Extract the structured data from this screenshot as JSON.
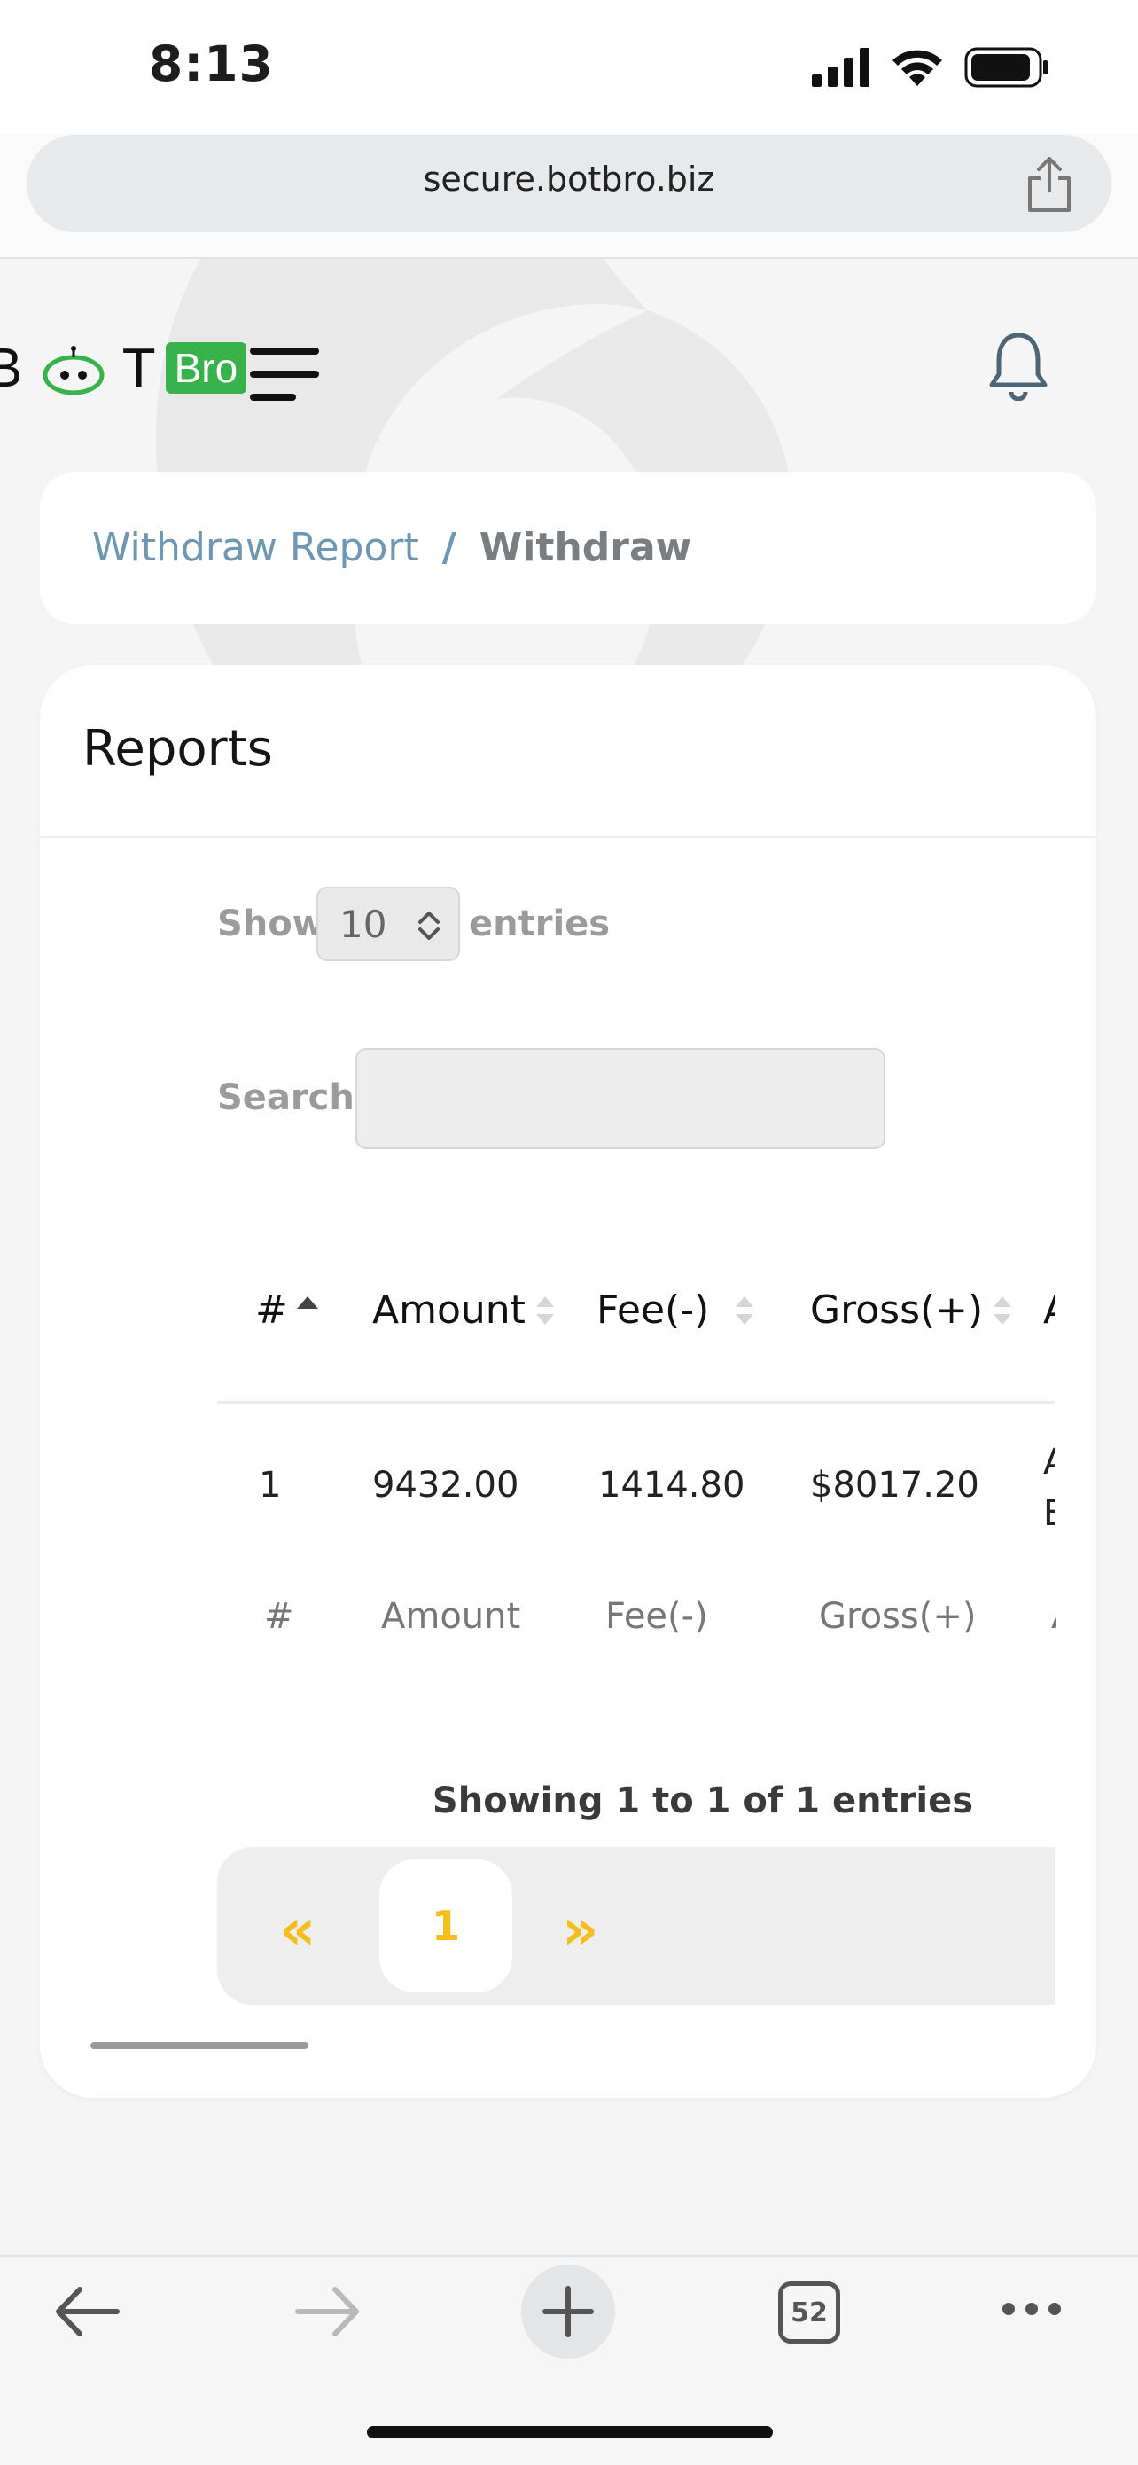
{
  "status_bar": {
    "time": "8:13"
  },
  "browser": {
    "url": "secure.botbro.biz",
    "tab_count": "52"
  },
  "header": {
    "logo_text": "B  T",
    "logo_badge": "Bro"
  },
  "breadcrumb": {
    "parent": "Withdraw Report",
    "separator": "/",
    "current": "Withdraw"
  },
  "card": {
    "title": "Reports"
  },
  "datatable": {
    "show_label": "Show",
    "show_value": "10",
    "entries_label": "entries",
    "search_label": "Search:",
    "search_value": "",
    "columns": [
      "#",
      "Amount",
      "Fee(-)",
      "Gross(+)",
      "A"
    ],
    "rows": [
      {
        "index": "1",
        "amount": "9432.00",
        "fee": "1414.80",
        "gross": "$8017.20",
        "extra_line1": "A",
        "extra_line2": "E"
      }
    ],
    "footer": [
      "#",
      "Amount",
      "Fee(-)",
      "Gross(+)",
      "A"
    ],
    "info": "Showing 1 to 1 of 1 entries",
    "pagination": {
      "prev": "«",
      "current": "1",
      "next": "»"
    }
  },
  "colors": {
    "accent": "#f5be1d",
    "link": "#6f97b3",
    "brand_green": "#38b24a"
  }
}
